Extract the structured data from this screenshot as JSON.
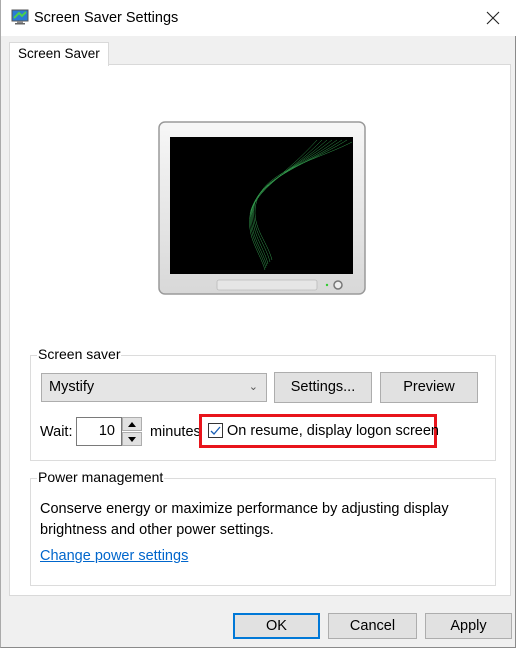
{
  "window": {
    "title": "Screen Saver Settings",
    "icon": "screen-saver-app-icon",
    "close_icon": "close-icon"
  },
  "tabs": [
    {
      "label": "Screen Saver",
      "active": true
    }
  ],
  "preview": {
    "icon": "monitor-preview-icon",
    "screen_color": "#000000",
    "accent_color": "#3fbf5f"
  },
  "screen_saver": {
    "group_label": "Screen saver",
    "selected": "Mystify",
    "settings_label": "Settings...",
    "preview_label": "Preview",
    "wait_label": "Wait:",
    "wait_value": "10",
    "minutes_label": "minutes",
    "logon_checkbox_label": "On resume, display logon screen",
    "logon_checked": true,
    "highlight_color": "#e8141b"
  },
  "power_management": {
    "group_label": "Power management",
    "description": "Conserve energy or maximize performance by adjusting display brightness and other power settings.",
    "link_label": "Change power settings",
    "link_color": "#0066cc"
  },
  "footer": {
    "ok_label": "OK",
    "cancel_label": "Cancel",
    "apply_label": "Apply"
  }
}
